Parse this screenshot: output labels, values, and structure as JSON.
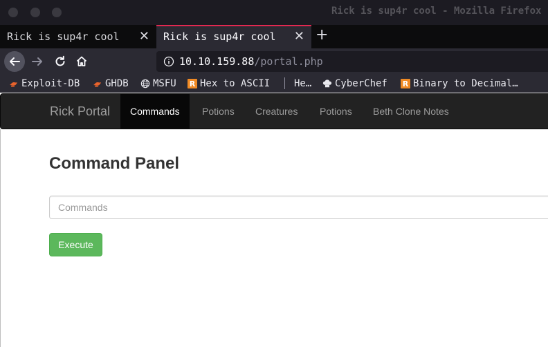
{
  "window": {
    "title": "Rick is sup4r cool - Mozilla Firefox"
  },
  "tabs": [
    {
      "title": "Rick is sup4r cool",
      "active": false
    },
    {
      "title": "Rick is sup4r cool",
      "active": true
    }
  ],
  "toolbar": {
    "url_host": "10.10.159.88",
    "url_path": "/portal.php"
  },
  "bookmarks": [
    {
      "label": "Exploit-DB",
      "icon": "exploit-db-icon"
    },
    {
      "label": "GHDB",
      "icon": "ghdb-icon"
    },
    {
      "label": "MSFU",
      "icon": "globe-icon"
    },
    {
      "label": "Hex to ASCII",
      "icon": "r-icon"
    },
    {
      "label": "He…",
      "icon": "none"
    },
    {
      "label": "CyberChef",
      "icon": "chef-hat-icon"
    },
    {
      "label": "Binary to Decimal…",
      "icon": "r-icon"
    }
  ],
  "site": {
    "brand": "Rick Portal",
    "nav": [
      {
        "label": "Commands",
        "active": true
      },
      {
        "label": "Potions",
        "active": false
      },
      {
        "label": "Creatures",
        "active": false
      },
      {
        "label": "Potions",
        "active": false
      },
      {
        "label": "Beth Clone Notes",
        "active": false
      }
    ],
    "panel_title": "Command Panel",
    "input_placeholder": "Commands",
    "input_value": "",
    "execute_label": "Execute"
  },
  "colors": {
    "tab_accent": "#e22850",
    "navbar_bg": "#222222",
    "active_nav_bg": "#080808",
    "execute_bg": "#5cb85c",
    "bookmark_r_icon": "#f08a24"
  }
}
